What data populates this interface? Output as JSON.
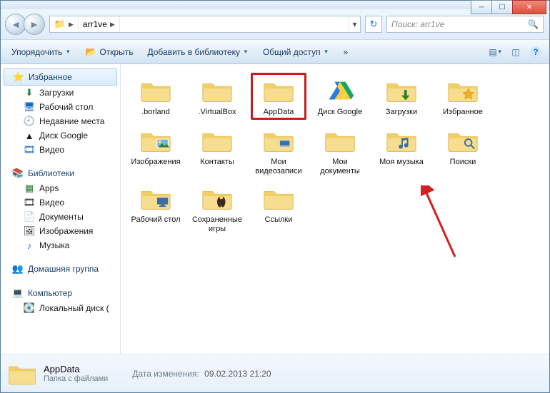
{
  "titlebar": {},
  "nav": {
    "path_root_name": "arr1ve",
    "search_placeholder": "Поиск: arr1ve"
  },
  "toolbar": {
    "organize": "Упорядочить",
    "open": "Открыть",
    "add_to_library": "Добавить в библиотеку",
    "share": "Общий доступ",
    "extra": "»"
  },
  "sidebar": {
    "favorites": {
      "label": "Избранное",
      "items": [
        "Загрузки",
        "Рабочий стол",
        "Недавние места",
        "Диск Google",
        "Видео"
      ]
    },
    "libraries": {
      "label": "Библиотеки",
      "items": [
        "Apps",
        "Видео",
        "Документы",
        "Изображения",
        "Музыка"
      ]
    },
    "homegroup": {
      "label": "Домашняя группа"
    },
    "computer": {
      "label": "Компьютер",
      "items": [
        "Локальный диск ("
      ]
    }
  },
  "items": [
    {
      "name": ".borland",
      "icon": "folder"
    },
    {
      "name": ".VirtualBox",
      "icon": "folder"
    },
    {
      "name": "AppData",
      "icon": "folder",
      "highlight": true
    },
    {
      "name": "Диск Google",
      "icon": "gdrive"
    },
    {
      "name": "Загрузки",
      "icon": "folder-dl"
    },
    {
      "name": "Избранное",
      "icon": "folder-star"
    },
    {
      "name": "Изображения",
      "icon": "folder-pic"
    },
    {
      "name": "Контакты",
      "icon": "folder"
    },
    {
      "name": "Мои видеозаписи",
      "icon": "folder-vid"
    },
    {
      "name": "Мои документы",
      "icon": "folder"
    },
    {
      "name": "Моя музыка",
      "icon": "folder-music"
    },
    {
      "name": "Поиски",
      "icon": "folder-search"
    },
    {
      "name": "Рабочий стол",
      "icon": "folder-desk"
    },
    {
      "name": "Сохраненные игры",
      "icon": "folder-game"
    },
    {
      "name": "Ссылки",
      "icon": "folder"
    }
  ],
  "details": {
    "name": "AppData",
    "type": "Папка с файлами",
    "date_label": "Дата изменения:",
    "date_value": "09.02.2013 21:20"
  }
}
